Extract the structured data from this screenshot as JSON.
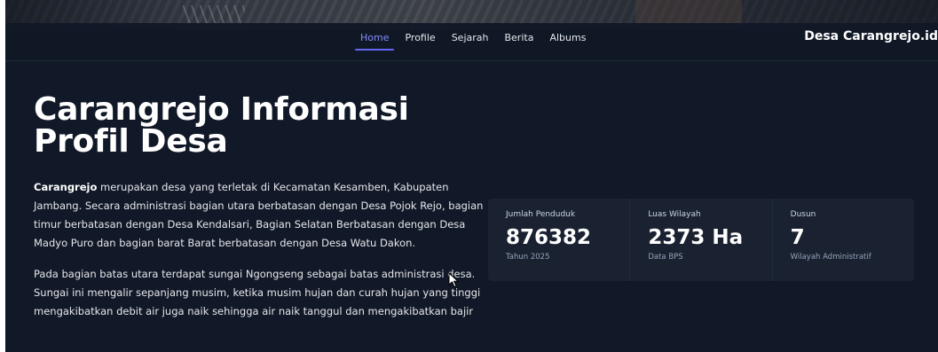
{
  "nav": {
    "links": [
      "Home",
      "Profile",
      "Sejarah",
      "Berita",
      "Albums"
    ],
    "active": "Home",
    "brand": "Desa Carangrejo.id"
  },
  "hero": {
    "title_line1": "Carangrejo Informasi",
    "title_line2": "Profil Desa",
    "para1_bold": "Carangrejo",
    "para1_rest": " merupakan desa yang terletak di Kecamatan Kesamben, Kabupaten Jambang. Secara administrasi bagian utara berbatasan dengan Desa Pojok Rejo, bagian timur berbatasan dengan Desa Kendalsari, Bagian Selatan Berbatasan dengan Desa Madyo Puro dan bagian barat Barat berbatasan dengan Desa Watu Dakon.",
    "para2": "Pada bagian batas utara terdapat sungai Ngongseng sebagai batas administrasi desa. Sungai ini mengalir sepanjang musim, ketika musim hujan dan curah hujan yang tinggi mengakibatkan debit air juga naik sehingga air naik tanggul dan mengakibatkan bajir"
  },
  "stats": [
    {
      "label": "Jumlah Penduduk",
      "value": "876382",
      "note": "Tahun 2025"
    },
    {
      "label": "Luas Wilayah",
      "value": "2373 Ha",
      "note": "Data BPS"
    },
    {
      "label": "Dusun",
      "value": "7",
      "note": "Wilayah Administratif"
    }
  ],
  "colors": {
    "background": "#111827",
    "accent": "#6366f1",
    "card": "#1a2232"
  }
}
